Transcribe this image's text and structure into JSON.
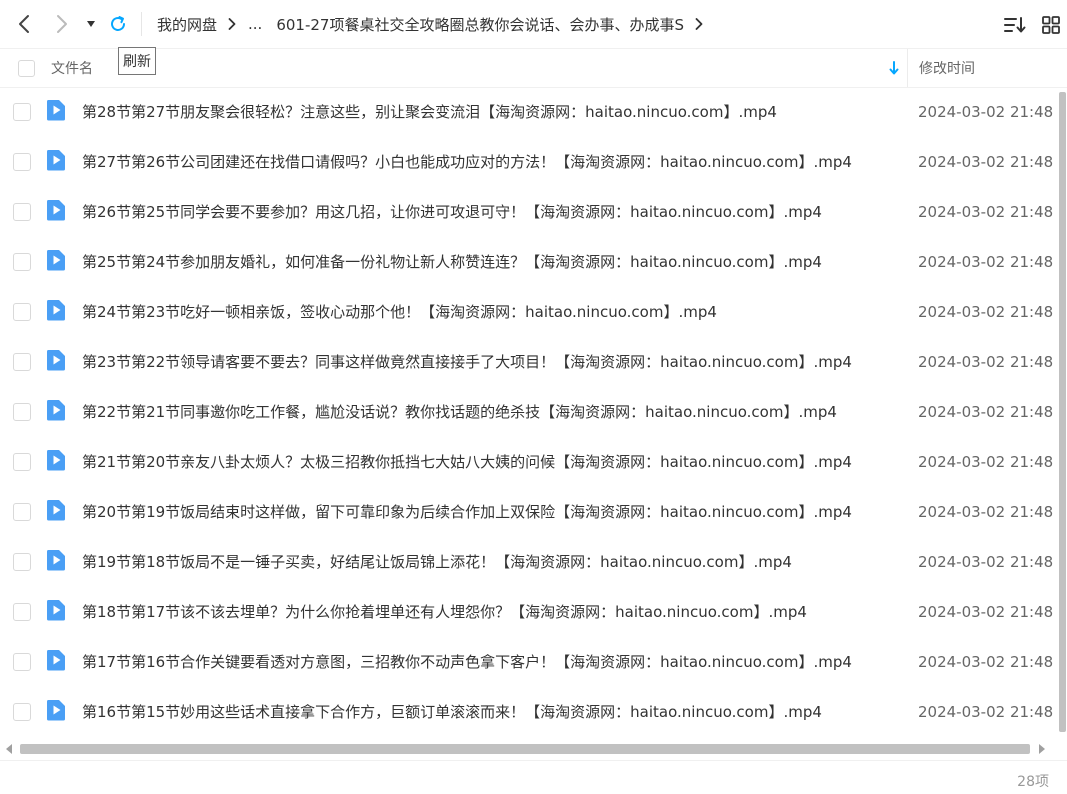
{
  "toolbar": {
    "back_icon": "chevron-left-icon",
    "forward_icon": "chevron-right-icon",
    "dropdown_icon": "caret-down-icon",
    "refresh_icon": "refresh-icon",
    "sort_icon": "sort-list-icon",
    "grid_icon": "grid-view-icon",
    "accent_color": "#06a7ff"
  },
  "breadcrumb": {
    "root": "我的网盘",
    "ellipsis": "...",
    "current": "601-27项餐桌社交全攻略圈总教你会说话、会办事、办成事S"
  },
  "tooltip": {
    "text": "刷新"
  },
  "header": {
    "name_label": "文件名",
    "time_label": "修改时间",
    "sort_icon": "arrow-down-icon"
  },
  "files": [
    {
      "name": "第28节第27节朋友聚会很轻松？注意这些，别让聚会变流泪【海淘资源网：haitao.nincuo.com】.mp4",
      "modified": "2024-03-02 21:48"
    },
    {
      "name": "第27节第26节公司团建还在找借口请假吗？小白也能成功应对的方法！【海淘资源网：haitao.nincuo.com】.mp4",
      "modified": "2024-03-02 21:48"
    },
    {
      "name": "第26节第25节同学会要不要参加？用这几招，让你进可攻退可守！【海淘资源网：haitao.nincuo.com】.mp4",
      "modified": "2024-03-02 21:48"
    },
    {
      "name": "第25节第24节参加朋友婚礼，如何准备一份礼物让新人称赞连连？【海淘资源网：haitao.nincuo.com】.mp4",
      "modified": "2024-03-02 21:48"
    },
    {
      "name": "第24节第23节吃好一顿相亲饭，签收心动那个他！【海淘资源网：haitao.nincuo.com】.mp4",
      "modified": "2024-03-02 21:48"
    },
    {
      "name": "第23节第22节领导请客要不要去？同事这样做竟然直接接手了大项目！【海淘资源网：haitao.nincuo.com】.mp4",
      "modified": "2024-03-02 21:48"
    },
    {
      "name": "第22节第21节同事邀你吃工作餐，尴尬没话说？教你找话题的绝杀技【海淘资源网：haitao.nincuo.com】.mp4",
      "modified": "2024-03-02 21:48"
    },
    {
      "name": "第21节第20节亲友八卦太烦人？太极三招教你抵挡七大姑八大姨的问候【海淘资源网：haitao.nincuo.com】.mp4",
      "modified": "2024-03-02 21:48"
    },
    {
      "name": "第20节第19节饭局结束时这样做，留下可靠印象为后续合作加上双保险【海淘资源网：haitao.nincuo.com】.mp4",
      "modified": "2024-03-02 21:48"
    },
    {
      "name": "第19节第18节饭局不是一锤子买卖，好结尾让饭局锦上添花！【海淘资源网：haitao.nincuo.com】.mp4",
      "modified": "2024-03-02 21:48"
    },
    {
      "name": "第18节第17节该不该去埋单？为什么你抢着埋单还有人埋怨你？【海淘资源网：haitao.nincuo.com】.mp4",
      "modified": "2024-03-02 21:48"
    },
    {
      "name": "第17节第16节合作关键要看透对方意图，三招教你不动声色拿下客户！【海淘资源网：haitao.nincuo.com】.mp4",
      "modified": "2024-03-02 21:48"
    },
    {
      "name": "第16节第15节妙用这些话术直接拿下合作方，巨额订单滚滚而来！【海淘资源网：haitao.nincuo.com】.mp4",
      "modified": "2024-03-02 21:48"
    }
  ],
  "file_icon": "video-file-icon",
  "footer": {
    "count": "28项"
  }
}
